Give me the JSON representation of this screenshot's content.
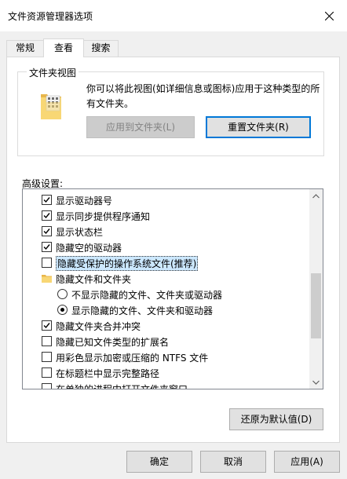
{
  "window": {
    "title": "文件资源管理器选项",
    "close_label": "×"
  },
  "tabs": [
    {
      "label": "常规",
      "active": false
    },
    {
      "label": "查看",
      "active": true
    },
    {
      "label": "搜索",
      "active": false
    }
  ],
  "folder_views": {
    "group_title": "文件夹视图",
    "description": "你可以将此视图(如详细信息或图标)应用于这种类型的所有文件夹。",
    "apply_button": "应用到文件夹(L)",
    "reset_button": "重置文件夹(R)"
  },
  "advanced": {
    "label": "高级设置:",
    "items": [
      {
        "type": "checkbox",
        "checked": true,
        "indent": 0,
        "label": "显示驱动器号"
      },
      {
        "type": "checkbox",
        "checked": true,
        "indent": 0,
        "label": "显示同步提供程序通知"
      },
      {
        "type": "checkbox",
        "checked": true,
        "indent": 0,
        "label": "显示状态栏"
      },
      {
        "type": "checkbox",
        "checked": true,
        "indent": 0,
        "label": "隐藏空的驱动器"
      },
      {
        "type": "checkbox",
        "checked": false,
        "indent": 0,
        "label": "隐藏受保护的操作系统文件(推荐)",
        "selected": true
      },
      {
        "type": "folder",
        "indent": 0,
        "label": "隐藏文件和文件夹"
      },
      {
        "type": "radio",
        "checked": false,
        "indent": 1,
        "label": "不显示隐藏的文件、文件夹或驱动器"
      },
      {
        "type": "radio",
        "checked": true,
        "indent": 1,
        "label": "显示隐藏的文件、文件夹和驱动器"
      },
      {
        "type": "checkbox",
        "checked": true,
        "indent": 0,
        "label": "隐藏文件夹合并冲突"
      },
      {
        "type": "checkbox",
        "checked": false,
        "indent": 0,
        "label": "隐藏已知文件类型的扩展名"
      },
      {
        "type": "checkbox",
        "checked": false,
        "indent": 0,
        "label": "用彩色显示加密或压缩的 NTFS 文件"
      },
      {
        "type": "checkbox",
        "checked": false,
        "indent": 0,
        "label": "在标题栏中显示完整路径"
      },
      {
        "type": "checkbox",
        "checked": false,
        "indent": 0,
        "label": "在单独的进程中打开文件夹窗口"
      }
    ],
    "restore_button": "还原为默认值(D)"
  },
  "footer": {
    "ok": "确定",
    "cancel": "取消",
    "apply": "应用(A)"
  },
  "colors": {
    "accent": "#0078d7",
    "selection": "#cce8ff",
    "folder": "#f8d775"
  }
}
